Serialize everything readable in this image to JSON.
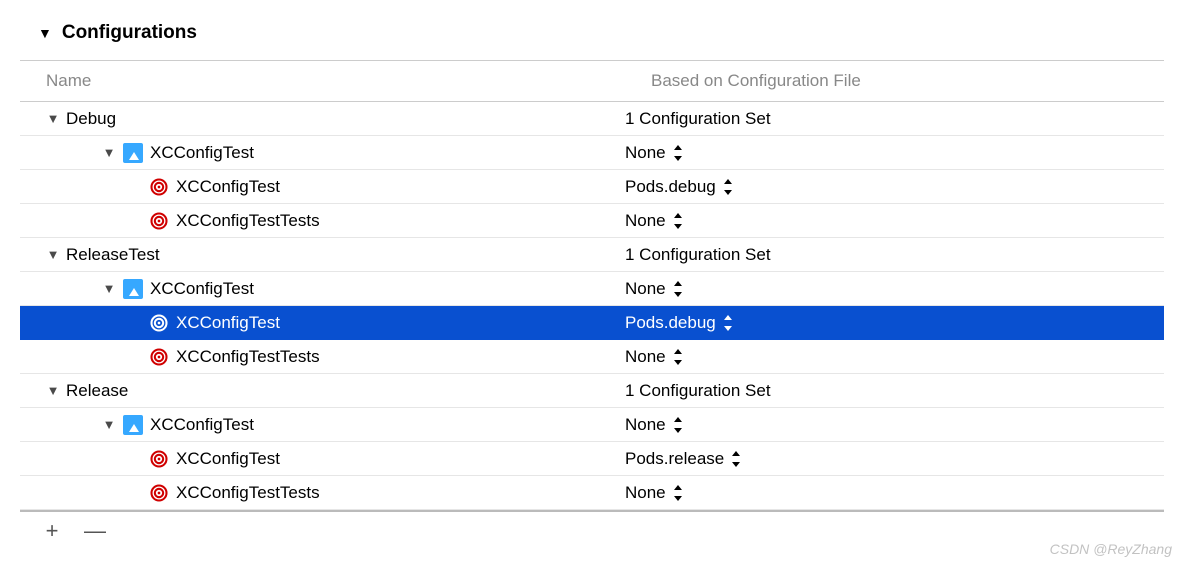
{
  "section": {
    "title": "Configurations"
  },
  "columns": {
    "name": "Name",
    "based": "Based on Configuration File"
  },
  "rows": [
    {
      "indent": 0,
      "name": "Debug",
      "value": "1 Configuration Set",
      "disclosure": true,
      "icon": null,
      "dropdown": false,
      "selected": false
    },
    {
      "indent": 1,
      "name": "XCConfigTest",
      "value": "None",
      "disclosure": true,
      "icon": "app",
      "dropdown": true,
      "selected": false
    },
    {
      "indent": 2,
      "name": "XCConfigTest",
      "value": "Pods.debug",
      "disclosure": false,
      "icon": "target",
      "dropdown": true,
      "selected": false
    },
    {
      "indent": 2,
      "name": "XCConfigTestTests",
      "value": "None",
      "disclosure": false,
      "icon": "target",
      "dropdown": true,
      "selected": false
    },
    {
      "indent": 0,
      "name": "ReleaseTest",
      "value": "1 Configuration Set",
      "disclosure": true,
      "icon": null,
      "dropdown": false,
      "selected": false
    },
    {
      "indent": 1,
      "name": "XCConfigTest",
      "value": "None",
      "disclosure": true,
      "icon": "app",
      "dropdown": true,
      "selected": false
    },
    {
      "indent": 2,
      "name": "XCConfigTest",
      "value": "Pods.debug",
      "disclosure": false,
      "icon": "target",
      "dropdown": true,
      "selected": true
    },
    {
      "indent": 2,
      "name": "XCConfigTestTests",
      "value": "None",
      "disclosure": false,
      "icon": "target",
      "dropdown": true,
      "selected": false
    },
    {
      "indent": 0,
      "name": "Release",
      "value": "1 Configuration Set",
      "disclosure": true,
      "icon": null,
      "dropdown": false,
      "selected": false
    },
    {
      "indent": 1,
      "name": "XCConfigTest",
      "value": "None",
      "disclosure": true,
      "icon": "app",
      "dropdown": true,
      "selected": false
    },
    {
      "indent": 2,
      "name": "XCConfigTest",
      "value": "Pods.release",
      "disclosure": false,
      "icon": "target",
      "dropdown": true,
      "selected": false
    },
    {
      "indent": 2,
      "name": "XCConfigTestTests",
      "value": "None",
      "disclosure": false,
      "icon": "target",
      "dropdown": true,
      "selected": false
    }
  ],
  "footer": {
    "add": "+",
    "remove": "—"
  },
  "watermark": "CSDN @ReyZhang"
}
